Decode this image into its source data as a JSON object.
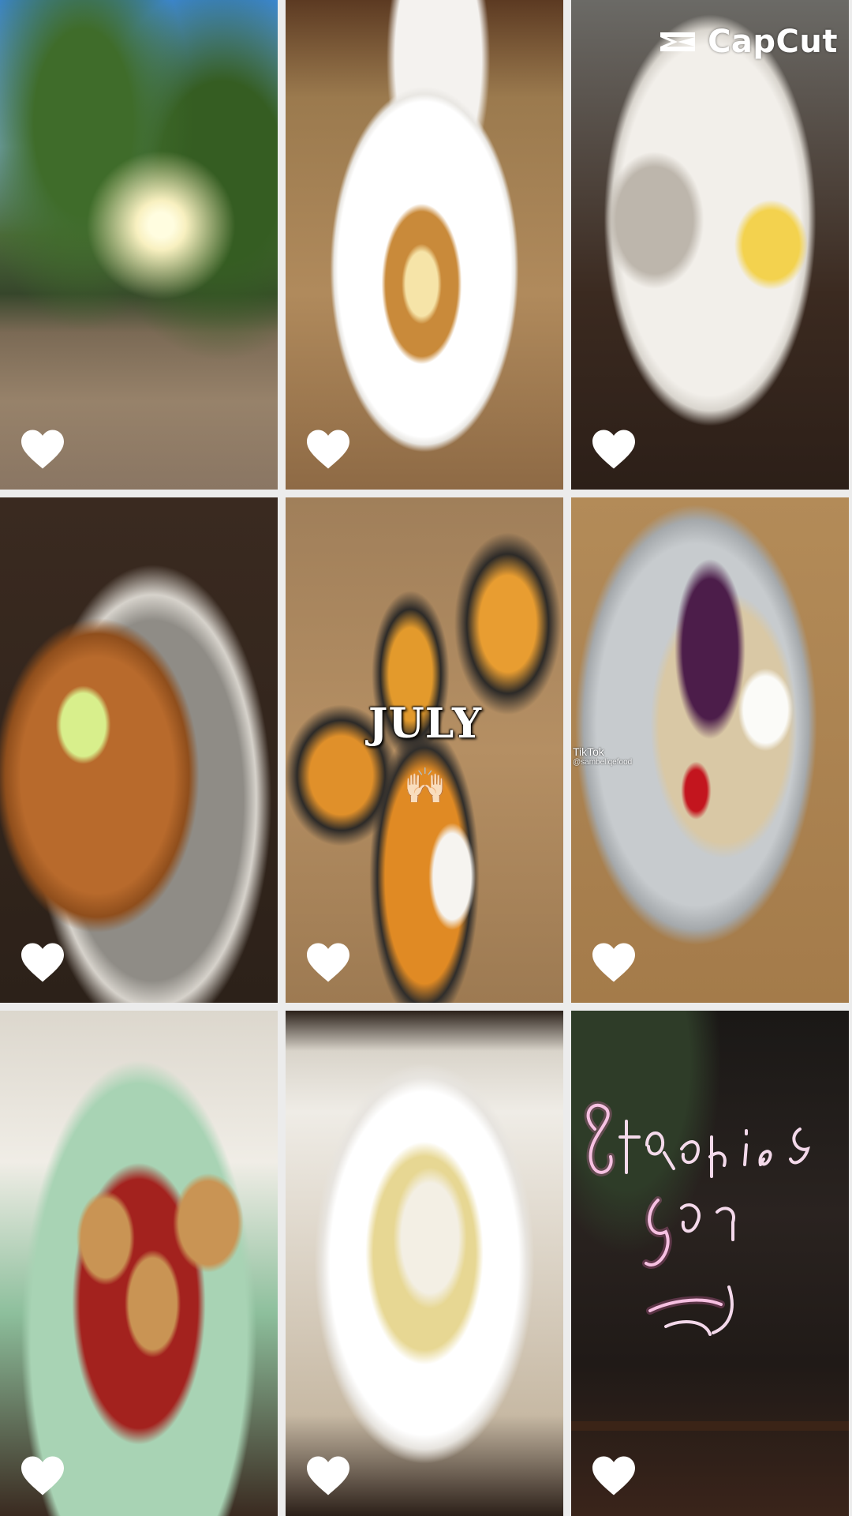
{
  "watermark": {
    "text": "CapCut",
    "icon": "capcut-logo-icon"
  },
  "overlay": {
    "title": "JULY",
    "emoji": "🙌🏻"
  },
  "source_tag": {
    "label": "TikTok",
    "handle": "@sambeliqefood"
  },
  "tiles": [
    {
      "icon": "heart-icon"
    },
    {
      "icon": "heart-icon"
    },
    {
      "icon": "heart-icon"
    },
    {
      "icon": "heart-icon"
    },
    {
      "icon": "heart-icon"
    },
    {
      "icon": "heart-icon"
    },
    {
      "icon": "heart-icon"
    },
    {
      "icon": "heart-icon"
    },
    {
      "icon": "heart-icon"
    }
  ],
  "colors": {
    "heart": "#ffffff",
    "grid_gap": "#ececec",
    "neon": "#ffd6f2"
  }
}
